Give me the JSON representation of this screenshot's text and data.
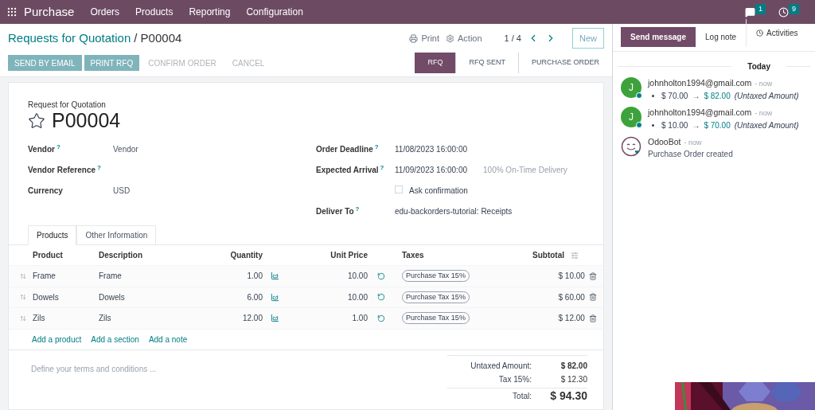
{
  "navbar": {
    "app_name": "Purchase",
    "menu": [
      "Orders",
      "Products",
      "Reporting",
      "Configuration"
    ],
    "messages_count": "1",
    "activities_count": "9"
  },
  "control_panel": {
    "breadcrumb_parent": "Requests for Quotation",
    "breadcrumb_separator": "/",
    "breadcrumb_current": "P00004",
    "print": "Print",
    "action": "Action",
    "pager": "1 / 4",
    "new_button": "New"
  },
  "buttons": [
    {
      "label": "SEND BY EMAIL",
      "kind": "primary"
    },
    {
      "label": "PRINT RFQ",
      "kind": "primary"
    },
    {
      "label": "CONFIRM ORDER",
      "kind": "plain"
    },
    {
      "label": "CANCEL",
      "kind": "plain"
    }
  ],
  "statusbar": [
    {
      "label": "RFQ",
      "selected": true
    },
    {
      "label": "RFQ SENT",
      "selected": false
    },
    {
      "label": "PURCHASE ORDER",
      "selected": false
    }
  ],
  "form": {
    "subtitle": "Request for Quotation",
    "name": "P00004",
    "starred": false,
    "left_fields": [
      {
        "label": "Vendor",
        "help": "?",
        "value": "Vendor"
      },
      {
        "label": "Vendor Reference",
        "help": "?"
      },
      {
        "label": "Currency",
        "value": "USD"
      }
    ],
    "right_fields": [
      {
        "label": "Order Deadline",
        "help": "?",
        "value": "11/08/2023 16:00:00",
        "kind": "text"
      },
      {
        "label": "Expected Arrival",
        "help": "?",
        "value": "11/09/2023 16:00:00",
        "note": "100% On-Time Delivery",
        "kind": "text"
      },
      {
        "kind": "checkbox",
        "value": "Ask confirmation",
        "checked": false
      },
      {
        "label": "Deliver To",
        "help": "?",
        "value": "edu-backorders-tutorial: Receipts",
        "kind": "text"
      }
    ]
  },
  "tabs": [
    {
      "label": "Products",
      "selected": true
    },
    {
      "label": "Other Information",
      "selected": false
    }
  ],
  "table": {
    "columns": [
      "Product",
      "Description",
      "Quantity",
      "Unit Price",
      "Taxes",
      "Subtotal"
    ],
    "rows": [
      {
        "product": "Frame",
        "description": "Frame",
        "quantity": "1.00",
        "unit_price": "10.00",
        "taxes": "Purchase Tax 15%",
        "subtotal": "$ 10.00"
      },
      {
        "product": "Dowels",
        "description": "Dowels",
        "quantity": "6.00",
        "unit_price": "10.00",
        "taxes": "Purchase Tax 15%",
        "subtotal": "$ 60.00"
      },
      {
        "product": "Zils",
        "description": "Zils",
        "quantity": "12.00",
        "unit_price": "1.00",
        "taxes": "Purchase Tax 15%",
        "subtotal": "$ 12.00"
      }
    ],
    "add_links": [
      "Add a product",
      "Add a section",
      "Add a note"
    ]
  },
  "terms": {
    "placeholder": "Define your terms and conditions ..."
  },
  "totals": [
    {
      "label": "Untaxed Amount:",
      "value": "$ 82.00",
      "kind": "bold"
    },
    {
      "label": "Tax 15%:",
      "value": "$ 12.30",
      "kind": "normal"
    },
    {
      "label": "Total:",
      "value": "$ 94.30",
      "kind": "grand"
    }
  ],
  "chatter": {
    "tabs": [
      {
        "label": "Send message",
        "selected": true
      },
      {
        "label": "Log note",
        "selected": false
      },
      {
        "label": "Activities",
        "selected": false
      }
    ],
    "date": "Today",
    "messages": [
      {
        "kind": "change",
        "avatar": "J",
        "author": "johnholton1994@gmail.com",
        "time": "- now",
        "old": "$ 70.00",
        "arrow": "→",
        "new": "$ 82.00",
        "field": "(Untaxed Amount)"
      },
      {
        "kind": "change",
        "avatar": "J",
        "author": "johnholton1994@gmail.com",
        "time": "- now",
        "old": "$ 10.00",
        "arrow": "→",
        "new": "$ 70.00",
        "field": "(Untaxed Amount)"
      },
      {
        "kind": "bot",
        "author": "OdooBot",
        "time": "- now",
        "body": "Purchase Order created"
      }
    ]
  }
}
